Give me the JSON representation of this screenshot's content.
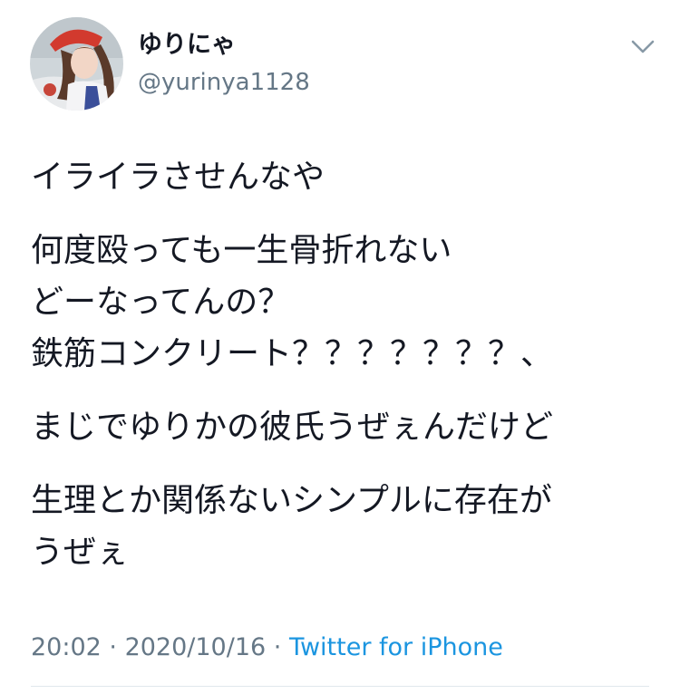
{
  "author": {
    "display_name": "ゆりにゃ",
    "handle": "@yurinya1128"
  },
  "tweet": {
    "paragraphs": [
      {
        "lines": [
          "イライラさせんなや"
        ]
      },
      {
        "lines": [
          "何度殴っても一生骨折れない",
          "どーなってんの？",
          "鉄筋コンクリート？？？？？？？、"
        ]
      },
      {
        "lines": [
          "まじでゆりかの彼氏うぜぇんだけど"
        ]
      },
      {
        "lines": [
          "生理とか関係ないシンプルに存在が",
          "うぜぇ"
        ]
      }
    ]
  },
  "meta": {
    "time": "20:02",
    "separator_1": " · ",
    "date": "2020/10/16",
    "separator_2": " · ",
    "source": "Twitter for iPhone"
  },
  "icons": {
    "menu": "chevron-down-icon",
    "avatar": "avatar"
  },
  "colors": {
    "text": "#141823",
    "secondary": "#657786",
    "link": "#1b95e0",
    "divider": "#e1e8ed"
  }
}
